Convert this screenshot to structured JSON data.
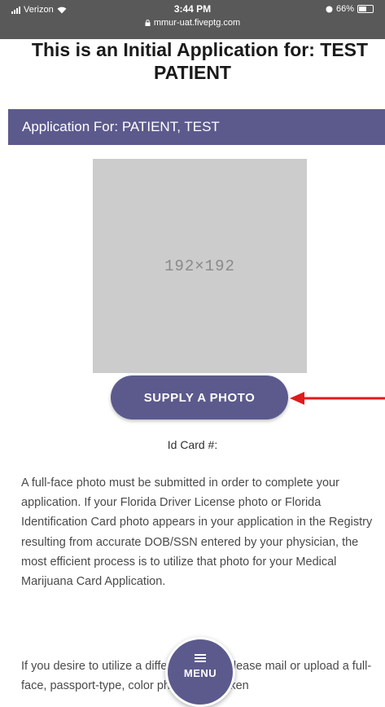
{
  "status_bar": {
    "carrier": "Verizon",
    "time": "3:44 PM",
    "battery": "66%",
    "battery_level": 0.66,
    "url": "mmur-uat.fiveptg.com"
  },
  "page": {
    "title_line1": "This is an Initial Application for: TEST",
    "title_line2": "PATIENT"
  },
  "application_header": {
    "label": "Application For: PATIENT, TEST"
  },
  "photo": {
    "placeholder_text": "192×192",
    "supply_button_label": "SUPPLY A PHOTO"
  },
  "id_card": {
    "label": "Id Card #:"
  },
  "instructions": {
    "paragraph1": "A full-face photo must be submitted in order to complete your application. If your Florida Driver License photo or Florida Identification Card photo appears in your application in the Registry resulting from accurate DOB/SSN entered by your physician, the most efficient process is to utilize that photo for your Medical Marijuana Card Application.",
    "paragraph2": "If you desire to utilize a different photo, please mail or upload a full-face, passport-type, color photograph taken"
  },
  "menu": {
    "label": "MENU"
  },
  "colors": {
    "accent": "#5c5a8c",
    "annotation_arrow": "#e01b1b"
  }
}
